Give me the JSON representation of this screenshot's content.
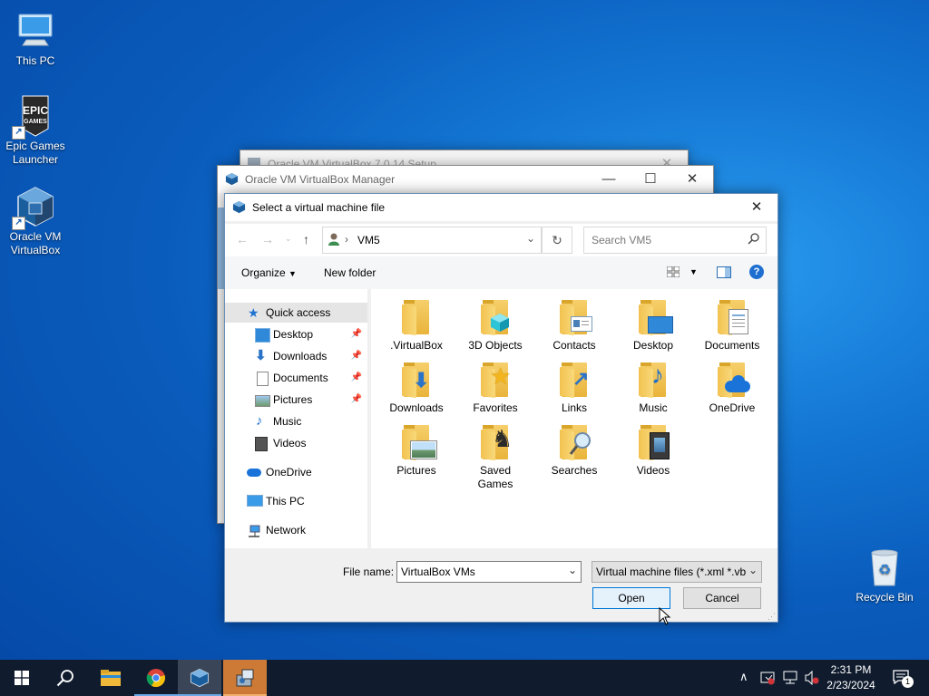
{
  "desktop": {
    "icons": [
      {
        "label": "This PC",
        "icon": "this-pc-icon"
      },
      {
        "label": "Epic Games Launcher",
        "line1": "Epic Games",
        "line2": "Launcher",
        "icon": "epic-games-icon",
        "logo_text1": "EPIC",
        "logo_text2": "GAMES"
      },
      {
        "label": "Oracle VM VirtualBox",
        "line1": "Oracle VM",
        "line2": "VirtualBox",
        "icon": "virtualbox-icon"
      },
      {
        "label": "Recycle Bin",
        "icon": "recycle-bin-icon"
      }
    ]
  },
  "windows": {
    "setup_title": "Oracle VM VirtualBox 7.0.14 Setup",
    "manager_title": "Oracle VM VirtualBox Manager"
  },
  "dialog": {
    "title": "Select a virtual machine file",
    "address": "VM5",
    "search_placeholder": "Search VM5",
    "organize_label": "Organize",
    "new_folder_label": "New folder",
    "nav": {
      "quick_access": "Quick access",
      "pinned": [
        "Desktop",
        "Downloads",
        "Documents",
        "Pictures"
      ],
      "unpinned": [
        "Music",
        "Videos"
      ],
      "onedrive": "OneDrive",
      "this_pc": "This PC",
      "network": "Network"
    },
    "files": [
      {
        "name": ".VirtualBox",
        "icon": "folder-icon"
      },
      {
        "name": "3D Objects",
        "icon": "3d-objects-folder-icon"
      },
      {
        "name": "Contacts",
        "icon": "contacts-folder-icon"
      },
      {
        "name": "Desktop",
        "icon": "desktop-folder-icon"
      },
      {
        "name": "Documents",
        "icon": "documents-folder-icon"
      },
      {
        "name": "Downloads",
        "icon": "downloads-folder-icon"
      },
      {
        "name": "Favorites",
        "icon": "favorites-folder-icon"
      },
      {
        "name": "Links",
        "icon": "links-folder-icon"
      },
      {
        "name": "Music",
        "icon": "music-folder-icon"
      },
      {
        "name": "OneDrive",
        "icon": "onedrive-folder-icon"
      },
      {
        "name": "Pictures",
        "icon": "pictures-folder-icon"
      },
      {
        "name": "Saved Games",
        "line1": "Saved",
        "line2": "Games",
        "icon": "saved-games-folder-icon"
      },
      {
        "name": "Searches",
        "icon": "searches-folder-icon"
      },
      {
        "name": "Videos",
        "icon": "videos-folder-icon"
      }
    ],
    "file_name_label": "File name:",
    "file_name_value": "VirtualBox VMs",
    "file_type": "Virtual machine files (*.xml *.vb",
    "open_label": "Open",
    "cancel_label": "Cancel"
  },
  "taskbar": {
    "time": "2:31 PM",
    "date": "2/23/2024",
    "notification_count": "1"
  },
  "colors": {
    "desktop": "#0a5cbc",
    "taskbar": "#101c2e",
    "accent": "#0078d7",
    "selection": "#cce8ff"
  }
}
